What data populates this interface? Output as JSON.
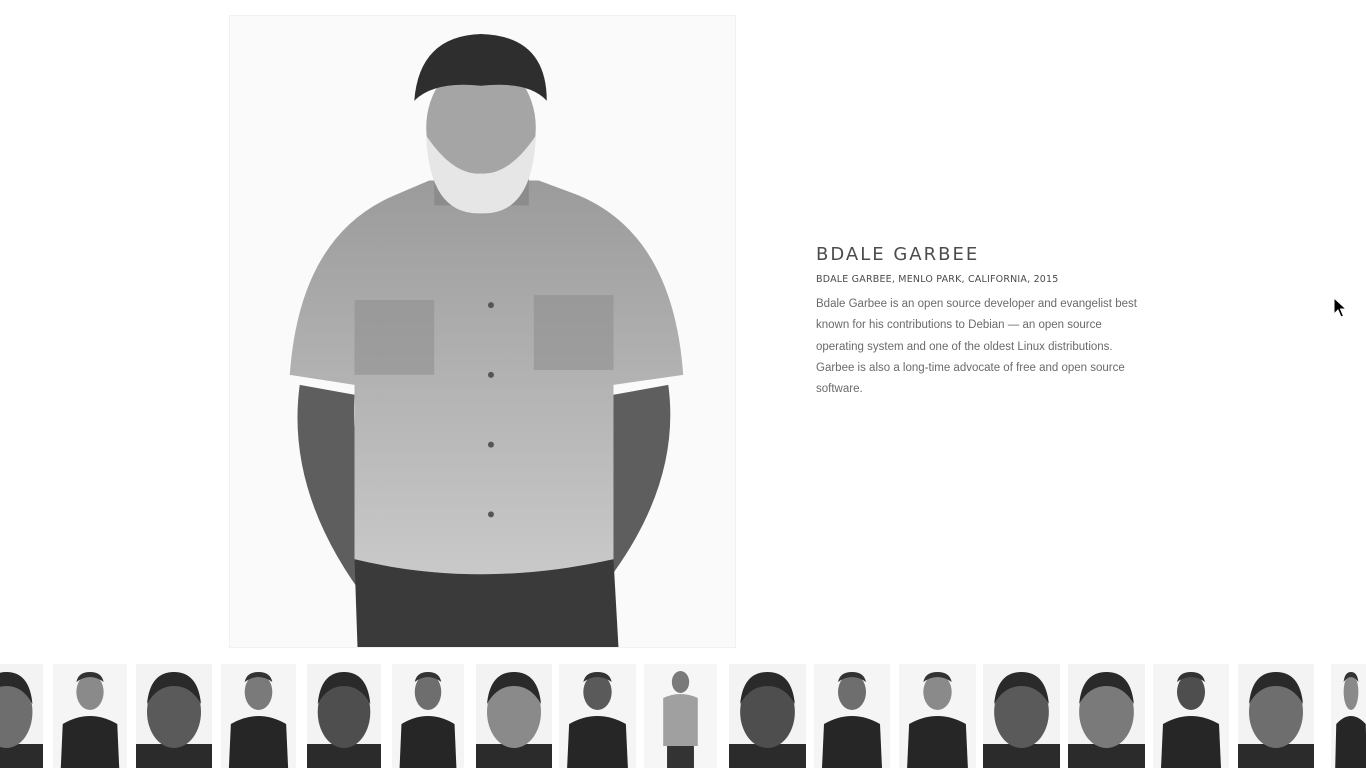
{
  "featured": {
    "name": "BDALE GARBEE",
    "caption": "BDALE GARBEE, MENLO PARK, CALIFORNIA, 2015",
    "bio": "Bdale Garbee is an open source developer and evangelist best known for his contributions to Debian — an open source operating system and one of the oldest Linux distributions. Garbee is also a long-time advocate of free and open source software.",
    "photo_icon": "portrait-photo"
  },
  "thumbnails": {
    "count": 17,
    "items": [
      {
        "id": "thumb-1"
      },
      {
        "id": "thumb-2"
      },
      {
        "id": "thumb-3"
      },
      {
        "id": "thumb-4"
      },
      {
        "id": "thumb-5"
      },
      {
        "id": "thumb-6"
      },
      {
        "id": "thumb-7"
      },
      {
        "id": "thumb-8"
      },
      {
        "id": "thumb-9"
      },
      {
        "id": "thumb-10"
      },
      {
        "id": "thumb-11"
      },
      {
        "id": "thumb-12"
      },
      {
        "id": "thumb-13"
      },
      {
        "id": "thumb-14"
      },
      {
        "id": "thumb-15"
      },
      {
        "id": "thumb-16"
      },
      {
        "id": "thumb-17"
      }
    ]
  },
  "colors": {
    "background": "#ffffff",
    "title": "#4c4c4c",
    "body_text": "#6a6a6a"
  }
}
